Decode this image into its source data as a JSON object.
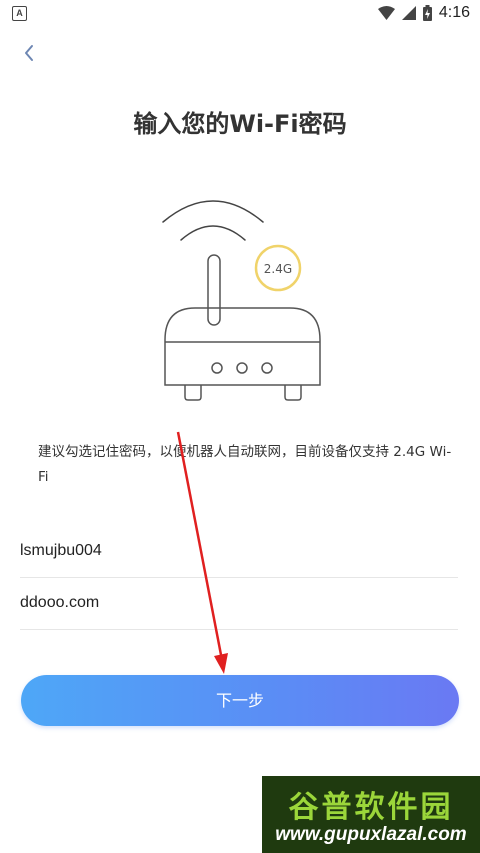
{
  "status_bar": {
    "app_icon_letter": "A",
    "time": "4:16"
  },
  "page": {
    "title": "输入您的Wi-Fi密码",
    "badge": "2.4G",
    "hint": "建议勾选记住密码，以便机器人自动联网，目前设备仅支持 2.4G Wi-Fi"
  },
  "form": {
    "ssid_value": "lsmujbu004",
    "password_value": "ddooo.com"
  },
  "actions": {
    "next_label": "下一步"
  },
  "watermark": {
    "brand": "谷普软件园",
    "url": "www.gupuxlazal.com"
  },
  "colors": {
    "badge_ring": "#f0d36a",
    "button_gradient_start": "#4ea7f7",
    "button_gradient_end": "#6a79f3",
    "annotation_arrow": "#e02020"
  }
}
